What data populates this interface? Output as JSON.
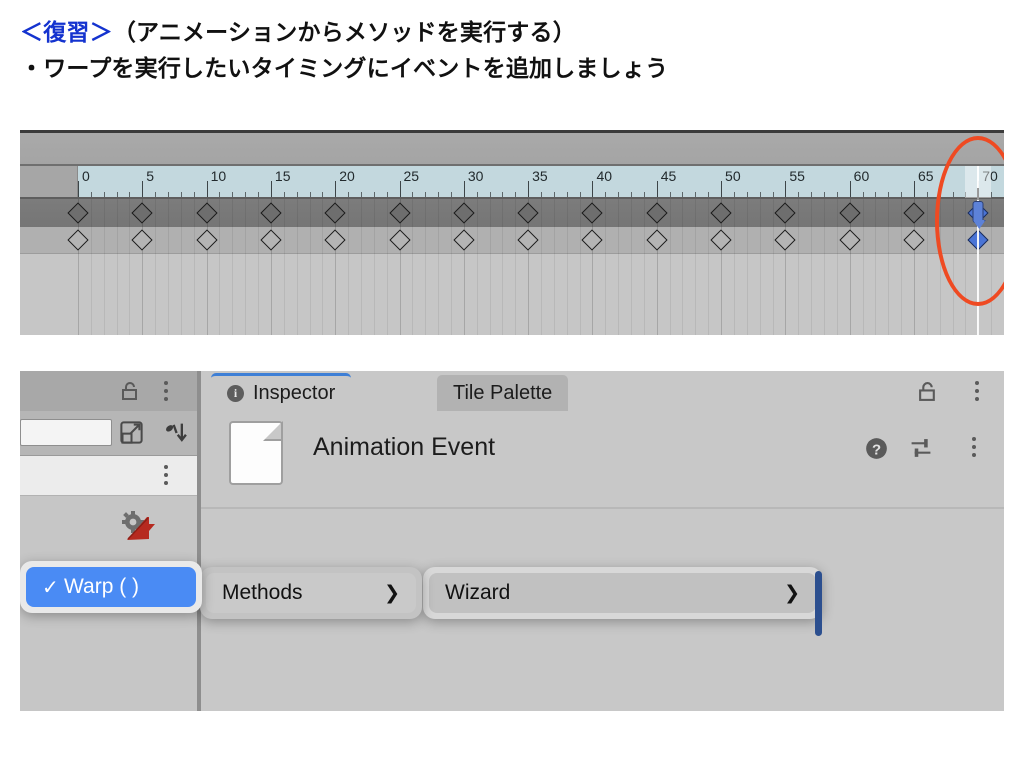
{
  "heading": {
    "line1_accent": "＜復習＞",
    "line1_rest": "（アニメーションからメソッドを実行する）",
    "line2": "・ワープを実行したいタイミングにイベントを追加しましょう",
    "accent_color": "#1433cf"
  },
  "timeline": {
    "ruler": {
      "unit": "frames",
      "major_step": 5,
      "minor_step": 1,
      "labels": [
        "0",
        "5",
        "10",
        "15",
        "20",
        "25",
        "30",
        "35",
        "40",
        "45",
        "50",
        "55",
        "60",
        "65",
        "70"
      ],
      "min": 0,
      "max": 72,
      "background_color": "#c3d8de"
    },
    "playhead": {
      "frame": 70,
      "color": "#5d82d8"
    },
    "rows": [
      {
        "name": "keyframe-row-1",
        "keyframes": [
          0,
          5,
          10,
          15,
          20,
          25,
          30,
          35,
          40,
          45,
          50,
          55,
          60,
          65,
          70
        ],
        "selected_frames": [
          70
        ]
      },
      {
        "name": "keyframe-row-2",
        "keyframes": [
          0,
          5,
          10,
          15,
          20,
          25,
          30,
          35,
          40,
          45,
          50,
          55,
          60,
          65,
          70
        ],
        "selected_frames": [
          70
        ]
      }
    ],
    "annotation": {
      "shape": "ellipse",
      "color": "#ef4a22",
      "target_frame": 70
    }
  },
  "editor": {
    "left_panel": {
      "lock_icon": "lock-open-icon",
      "menu_icon": "kebab-menu-icon",
      "search_field_value": "",
      "expand_icon": "expand-icon",
      "sort_icon": "sort-icon",
      "asset_icon": "animation-clip-icon"
    },
    "tabs": [
      {
        "label": "Inspector",
        "icon": "info-icon",
        "active": true
      },
      {
        "label": "Tile Palette",
        "icon": "",
        "active": false
      }
    ],
    "tab_controls": {
      "lock_icon": "lock-open-icon",
      "menu_icon": "kebab-menu-icon"
    },
    "inspector": {
      "title": "Animation Event",
      "icon": "document-icon",
      "help_icon": "help-icon",
      "preset_icon": "preset-settings-icon",
      "menu_icon": "kebab-menu-icon"
    },
    "context_menu": {
      "panels": [
        {
          "name": "selected-method-panel",
          "items": [
            {
              "label": "Warp ( )",
              "checked": true,
              "selected": true,
              "submenu": false
            }
          ]
        },
        {
          "name": "methods-panel",
          "items": [
            {
              "label": "Methods",
              "checked": false,
              "selected": false,
              "submenu": true
            }
          ]
        },
        {
          "name": "wizard-panel",
          "items": [
            {
              "label": "Wizard",
              "checked": false,
              "selected": false,
              "submenu": true
            }
          ]
        }
      ],
      "check_glyph": "✓",
      "arrow_glyph": "❯",
      "highlight_color": "#4a8bf4"
    }
  }
}
